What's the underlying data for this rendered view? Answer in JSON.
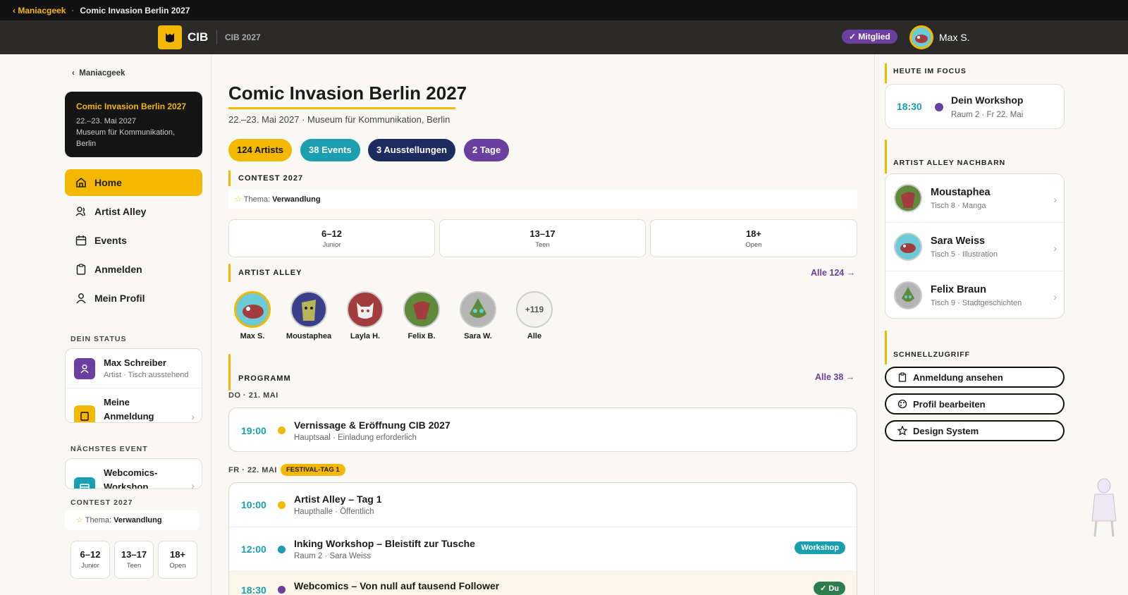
{
  "topbar": {
    "back": "Maniacgeek",
    "title": "Comic Invasion Berlin 2027"
  },
  "header": {
    "brand": "CIB",
    "sub": "CIB 2027",
    "member": "Mitglied",
    "user": "Max S."
  },
  "sidebar": {
    "back": "Maniacgeek",
    "event": {
      "title": "Comic Invasion Berlin 2027",
      "date": "22.–23. Mai 2027",
      "place": "Museum für Kommunikation, Berlin"
    },
    "nav": [
      {
        "label": "Home"
      },
      {
        "label": "Artist Alley"
      },
      {
        "label": "Events"
      },
      {
        "label": "Anmelden"
      },
      {
        "label": "Mein Profil"
      }
    ],
    "status_head": "DEIN STATUS",
    "status": [
      {
        "title": "Max Schreiber",
        "sub": "Artist · Tisch ausstehend"
      },
      {
        "title": "Meine Anmeldung"
      }
    ],
    "next_head": "NÄCHSTES EVENT",
    "next": {
      "title": "Webcomics-Workshop"
    },
    "contest_head": "CONTEST 2027",
    "contest": {
      "theme_label": "Thema:",
      "theme": "Verwandlung"
    },
    "ages": [
      {
        "range": "6–12",
        "label": "Junior"
      },
      {
        "range": "13–17",
        "label": "Teen"
      },
      {
        "range": "18+",
        "label": "Open"
      }
    ]
  },
  "main": {
    "title": "Comic Invasion Berlin 2027",
    "meta": "22.–23. Mai 2027 · Museum für Kommunikation, Berlin",
    "pills": [
      "124 Artists",
      "38 Events",
      "3 Ausstellungen",
      "2 Tage"
    ],
    "contest_head": "CONTEST 2027",
    "theme_label": "Thema:",
    "theme": "Verwandlung",
    "ages": [
      {
        "range": "6–12",
        "label": "Junior"
      },
      {
        "range": "13–17",
        "label": "Teen"
      },
      {
        "range": "18+",
        "label": "Open"
      }
    ],
    "alley_head": "ARTIST ALLEY",
    "alley_all": "Alle 124 →",
    "artists": [
      {
        "name": "Max S."
      },
      {
        "name": "Moustaphea"
      },
      {
        "name": "Layla H."
      },
      {
        "name": "Felix B."
      },
      {
        "name": "Sara W."
      },
      {
        "name": "Alle",
        "badge": "+119"
      }
    ],
    "prog_head": "PROGRAMM",
    "prog_all": "Alle 38 →",
    "day1": "DO · 21. MAI",
    "day2": "FR · 22. MAI",
    "day2_tag": "FESTIVAL-TAG 1",
    "events1": [
      {
        "time": "19:00",
        "title": "Vernissage & Eröffnung CIB 2027",
        "sub": "Hauptsaal · Einladung erforderlich",
        "color": "#f5b800"
      }
    ],
    "events2": [
      {
        "time": "10:00",
        "title": "Artist Alley – Tag 1",
        "sub": "Haupthalle · Öffentlich",
        "color": "#f5b800"
      },
      {
        "time": "12:00",
        "title": "Inking Workshop – Bleistift zur Tusche",
        "sub": "Raum 2 · Sara Weiss",
        "color": "#1a9fb0",
        "tag": "Workshop"
      },
      {
        "time": "18:30",
        "title": "Webcomics – Von null auf tausend Follower",
        "sub": "",
        "color": "#6b3fa0",
        "tag": "✓ Du"
      }
    ]
  },
  "right": {
    "focus_head": "HEUTE IM FOCUS",
    "focus": {
      "time": "18:30",
      "title": "Dein Workshop",
      "sub": "Raum 2 · Fr 22. Mai"
    },
    "neighbors_head": "ARTIST ALLEY NACHBARN",
    "neighbors": [
      {
        "name": "Moustaphea",
        "sub": "Tisch 8 · Manga"
      },
      {
        "name": "Sara Weiss",
        "sub": "Tisch 5 · Illustration"
      },
      {
        "name": "Felix Braun",
        "sub": "Tisch 9 · Stadtgeschichten"
      }
    ],
    "quick_head": "SCHNELLZUGRIFF",
    "quick": [
      "Anmeldung ansehen",
      "Profil bearbeiten",
      "Design System"
    ]
  }
}
